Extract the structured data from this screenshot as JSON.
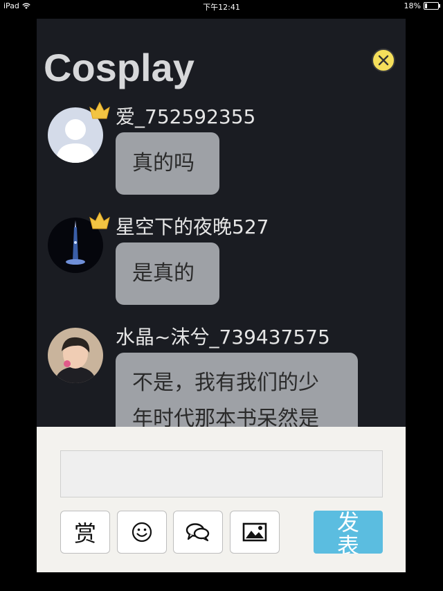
{
  "status_bar": {
    "device": "iPad",
    "time": "下午12:41",
    "battery_text": "18%",
    "battery_level": 0.18
  },
  "header": {
    "title": "Cosplay",
    "close_icon": "close-icon",
    "close_color": "#f5df5b"
  },
  "messages": [
    {
      "nick": "爱_752592355",
      "text": "真的吗",
      "avatar": "default-avatar",
      "badge": "crown-icon"
    },
    {
      "nick": "星空下的夜晚527",
      "text": "是真的",
      "avatar": "night-tower-avatar",
      "badge": "crown-icon"
    },
    {
      "nick": "水晶~沫兮_739437575",
      "text": "不是，我有我们的少",
      "text_line2": "年时代那本书呆然是",
      "avatar": "user-photo-avatar"
    }
  ],
  "composer": {
    "input_value": "",
    "tools": [
      {
        "label": "赏"
      },
      {
        "icon": "smiley-icon"
      },
      {
        "icon": "chat-bubbles-icon"
      },
      {
        "icon": "image-icon"
      }
    ],
    "send_label": "发表",
    "send_color": "#5bbde0"
  }
}
